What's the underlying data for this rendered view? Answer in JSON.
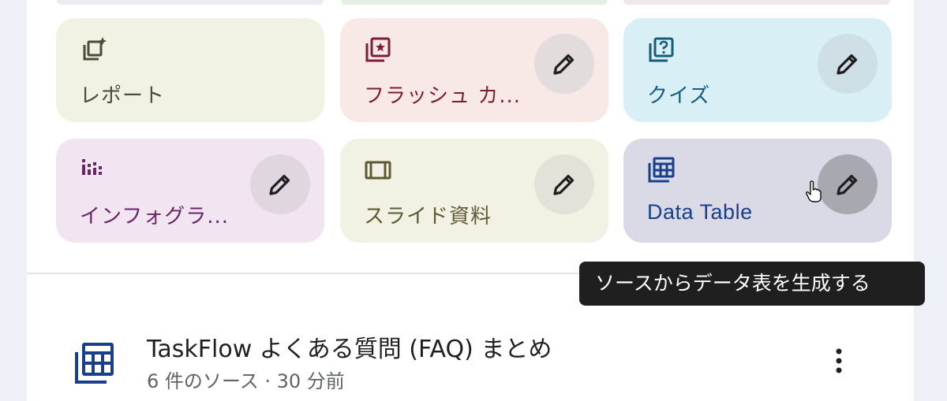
{
  "colors": {
    "report_bg": "#f1f2e4",
    "report_fg": "#4d4a36",
    "flash_bg": "#f8e8e6",
    "flash_fg": "#7a1f36",
    "quiz_bg": "#d9eff6",
    "quiz_fg": "#145c7a",
    "info_bg": "#f1e5f1",
    "info_fg": "#6b2566",
    "slide_bg": "#f1f2e4",
    "slide_fg": "#5f5933",
    "table_bg": "#d9dae6",
    "table_fg": "#1a3f8a",
    "edit_btn_bg": "#e2e2e4",
    "edit_btn_hover_bg": "#a8a8b0"
  },
  "studio_cards": [
    {
      "label": "レポート",
      "icon": "report-sparkle-icon",
      "has_edit": false
    },
    {
      "label": "フラッシュ カ...",
      "icon": "flashcards-icon",
      "has_edit": true
    },
    {
      "label": "クイズ",
      "icon": "quiz-icon",
      "has_edit": true
    },
    {
      "label": "インフォグラ...",
      "icon": "infographic-icon",
      "has_edit": true
    },
    {
      "label": "スライド資料",
      "icon": "slides-icon",
      "has_edit": true
    },
    {
      "label": "Data Table",
      "icon": "data-table-icon",
      "has_edit": true,
      "hovered": true
    }
  ],
  "tooltip": {
    "text": "ソースからデータ表を生成する"
  },
  "notebook": {
    "icon": "data-table-icon",
    "title": "TaskFlow よくある質問 (FAQ) まとめ",
    "meta": "6 件のソース · 30 分前"
  }
}
